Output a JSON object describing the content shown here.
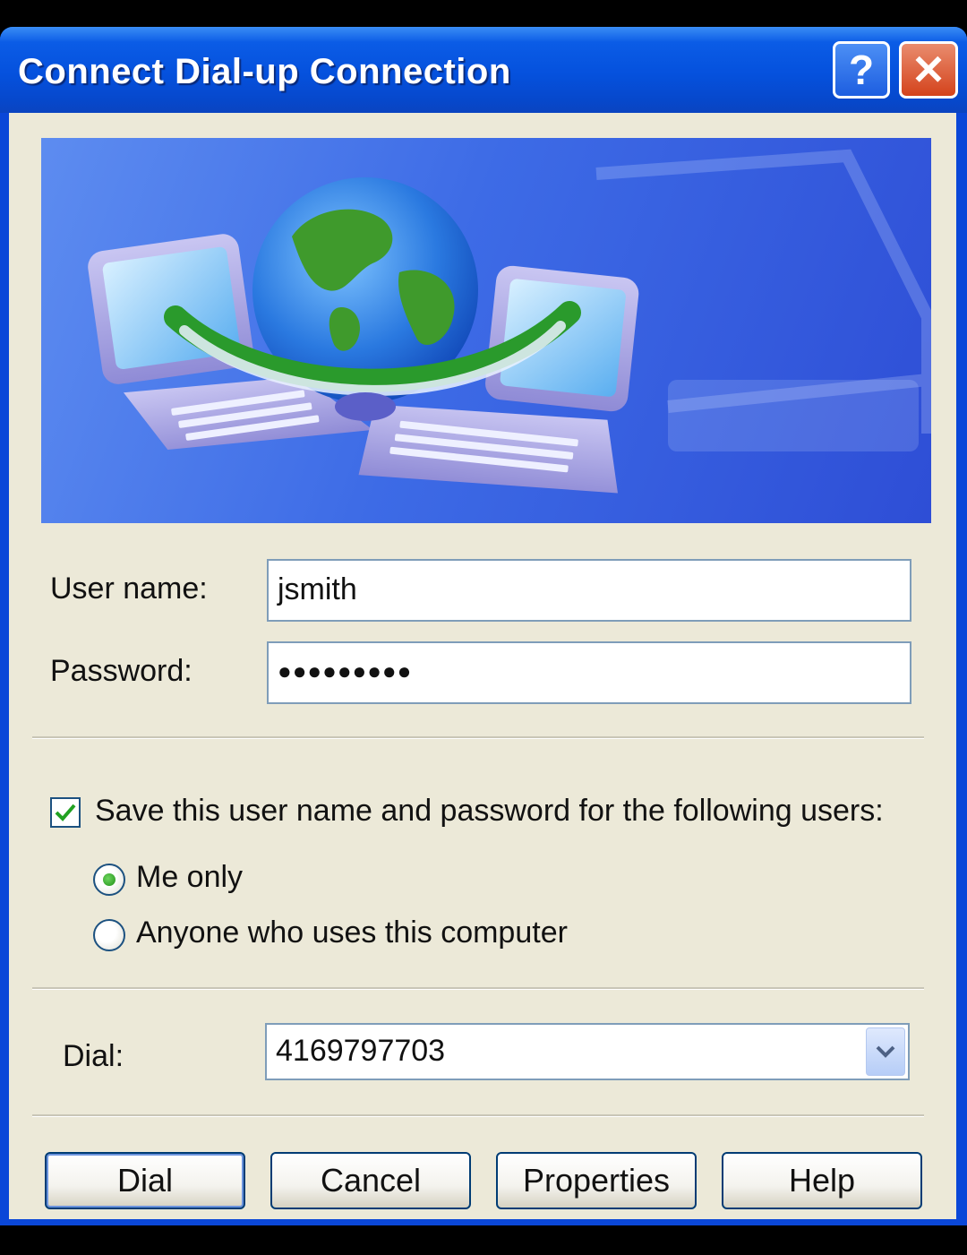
{
  "window": {
    "title": "Connect Dial-up Connection",
    "help_button": "?",
    "close_button": "✕"
  },
  "form": {
    "user_name_label": "User name:",
    "user_name_value": "jsmith",
    "password_label": "Password:",
    "password_value": "●●●●●●●●●",
    "save_checkbox_label": "Save this user name and password for the following users:",
    "save_checked": true,
    "radio_me_only": "Me only",
    "radio_anyone": "Anyone who uses this computer",
    "selected_radio": "me_only",
    "dial_label": "Dial:",
    "dial_value": "4169797703"
  },
  "buttons": {
    "dial": "Dial",
    "cancel": "Cancel",
    "properties": "Properties",
    "help": "Help"
  },
  "colors": {
    "titlebar": "#0551dd",
    "close_button": "#d4431c",
    "dialog_background": "#ece9d8"
  },
  "icons": {
    "banner": "network-globe-laptops-icon",
    "combo_arrow": "chevron-down-icon"
  }
}
